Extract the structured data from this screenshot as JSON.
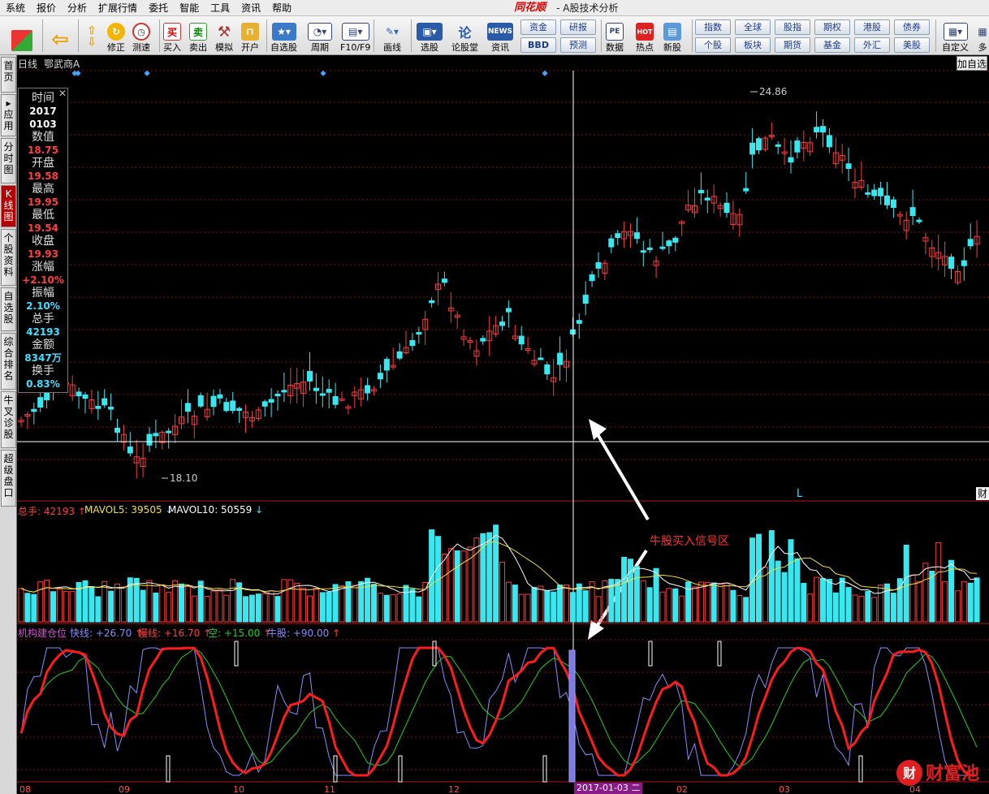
{
  "menu": [
    "系统",
    "报价",
    "分析",
    "扩展行情",
    "委托",
    "智能",
    "工具",
    "资讯",
    "帮助"
  ],
  "brand": "同花顺",
  "brand_sub": "- A股技术分析",
  "toolbar": {
    "buttons": [
      {
        "label": "修正",
        "icon": "up-arrow-icon"
      },
      {
        "label": "测速",
        "icon": "clock-icon"
      },
      {
        "label": "买入",
        "icon": "buy-icon",
        "glyph": "买"
      },
      {
        "label": "卖出",
        "icon": "sell-icon",
        "glyph": "卖"
      },
      {
        "label": "模拟",
        "icon": "hammer-icon"
      },
      {
        "label": "开户",
        "icon": "lock-icon"
      },
      {
        "label": "自选股",
        "icon": "star-icon"
      },
      {
        "label": "周期",
        "icon": "cycle-icon"
      },
      {
        "label": "F10/F9",
        "icon": "f10-icon"
      },
      {
        "label": "画线",
        "icon": "pen-icon"
      },
      {
        "label": "选股",
        "icon": "monitor-icon"
      },
      {
        "label": "论股堂",
        "icon": "forum-icon"
      },
      {
        "label": "资讯",
        "icon": "news-icon",
        "glyph": "NEWS"
      },
      {
        "label": "数据",
        "icon": "pe-icon",
        "glyph": "PE"
      },
      {
        "label": "热点",
        "icon": "hot-icon",
        "glyph": "HOT"
      },
      {
        "label": "新股",
        "icon": "newstock-icon"
      },
      {
        "label": "自定义",
        "icon": "custom-icon"
      },
      {
        "label": "多",
        "icon": "more-icon"
      }
    ],
    "grid1": [
      "资金",
      "研报",
      "BBD",
      "预测"
    ],
    "grid2": [
      "指数",
      "全球",
      "股指",
      "期权",
      "港股",
      "债券",
      "个股",
      "板块",
      "期货",
      "基金",
      "外汇",
      "美股"
    ]
  },
  "left_tabs": [
    "首页",
    "应用",
    "分时图",
    "K线图",
    "个股资料",
    "自选股",
    "综合排名",
    "牛叉诊股",
    "超级盘口"
  ],
  "chart": {
    "period": "日线",
    "stock": "鄂武商A",
    "right_button": "加自选",
    "high_label": "24.86",
    "low_label": "18.10",
    "marker_l": "L",
    "cai": "财"
  },
  "info": {
    "time_label": "时间",
    "time_year": "2017",
    "time_md": "0103",
    "value_label": "数值",
    "value": "18.75",
    "open_label": "开盘",
    "open": "19.58",
    "high_label": "最高",
    "high": "19.95",
    "low_label": "最低",
    "low": "19.54",
    "close_label": "收盘",
    "close": "19.93",
    "chg_label": "涨幅",
    "chg": "+2.10%",
    "amp_label": "振幅",
    "amp": "2.10%",
    "vol_label": "总手",
    "vol": "42193",
    "amt_label": "金额",
    "amt": "8347万",
    "turn_label": "换手",
    "turn": "0.83%"
  },
  "volume_header": {
    "vol": "总手: 42193",
    "ma5": "MAVOL5: 39505",
    "ma10": "MAVOL10: 50559"
  },
  "indicator_header": {
    "name": "机构建仓位",
    "fast": "快线: +26.70",
    "slow": "慢线: +16.70",
    "empty": "空: +15.00",
    "bull": "牛股: +90.00"
  },
  "annotation": "牛股买入信号区",
  "dates": [
    "08",
    "09",
    "10",
    "11",
    "12",
    "02",
    "03",
    "04"
  ],
  "cursor_date": "2017-01-03 二",
  "colors": {
    "up": "#ff3b3b",
    "down": "#38e8f0",
    "ma5": "#ffffff",
    "ma10": "#f0e040",
    "fast": "#8c8cff",
    "slow": "#ff1c1c",
    "mid": "#20d020",
    "cross": "#ffffff",
    "grid": "#7a1010"
  }
}
